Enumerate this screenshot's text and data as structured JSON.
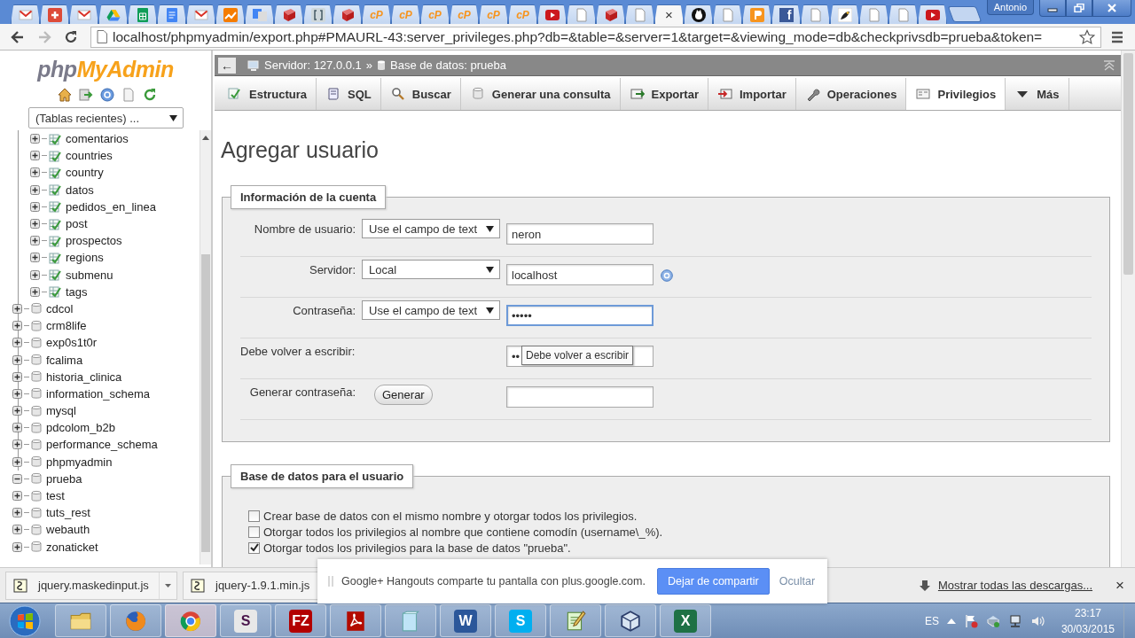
{
  "browser": {
    "tabs": [
      {
        "selected": false
      },
      {
        "selected": false
      },
      {
        "selected": false
      },
      {
        "selected": false
      },
      {
        "selected": false
      },
      {
        "selected": false
      },
      {
        "selected": false
      },
      {
        "selected": false
      },
      {
        "selected": false
      },
      {
        "selected": false
      },
      {
        "selected": false
      },
      {
        "selected": false
      },
      {
        "selected": false,
        "glyph": "cP"
      },
      {
        "selected": false,
        "glyph": "cP"
      },
      {
        "selected": false,
        "glyph": "cP"
      },
      {
        "selected": false,
        "glyph": "cP"
      },
      {
        "selected": false,
        "glyph": "cP"
      },
      {
        "selected": false,
        "glyph": "cP"
      },
      {
        "selected": false
      },
      {
        "selected": false
      },
      {
        "selected": false
      },
      {
        "selected": false
      },
      {
        "selected": true,
        "close": "×"
      },
      {
        "selected": false
      },
      {
        "selected": false
      },
      {
        "selected": false
      },
      {
        "selected": false,
        "glyph": "f"
      },
      {
        "selected": false
      },
      {
        "selected": false
      },
      {
        "selected": false
      },
      {
        "selected": false
      },
      {
        "selected": false
      }
    ],
    "profile": "Antonio",
    "url": "localhost/phpmyadmin/export.php#PMAURL-43:server_privileges.php?db=&table=&server=1&target=&viewing_mode=db&checkprivsdb=prueba&token="
  },
  "sidebar": {
    "logo": {
      "php": "php",
      "brand": "MyAdmin"
    },
    "recent_tables": "(Tablas recientes) ...",
    "tables": [
      {
        "name": "comentarios"
      },
      {
        "name": "countries"
      },
      {
        "name": "country"
      },
      {
        "name": "datos"
      },
      {
        "name": "pedidos_en_linea"
      },
      {
        "name": "post"
      },
      {
        "name": "prospectos"
      },
      {
        "name": "regions"
      },
      {
        "name": "submenu"
      },
      {
        "name": "tags"
      }
    ],
    "databases": [
      {
        "name": "cdcol",
        "expanded": false
      },
      {
        "name": "crm8life",
        "expanded": false
      },
      {
        "name": "exp0s1t0r",
        "expanded": false
      },
      {
        "name": "fcalima",
        "expanded": false
      },
      {
        "name": "historia_clinica",
        "expanded": false
      },
      {
        "name": "information_schema",
        "expanded": false
      },
      {
        "name": "mysql",
        "expanded": false
      },
      {
        "name": "pdcolom_b2b",
        "expanded": false
      },
      {
        "name": "performance_schema",
        "expanded": false
      },
      {
        "name": "phpmyadmin",
        "expanded": false
      },
      {
        "name": "prueba",
        "expanded": true
      },
      {
        "name": "test",
        "expanded": false
      },
      {
        "name": "tuts_rest",
        "expanded": false
      },
      {
        "name": "webauth",
        "expanded": false
      },
      {
        "name": "zonaticket",
        "expanded": false
      }
    ]
  },
  "breadcrumb": {
    "back": "←",
    "server": "Servidor: 127.0.0.1",
    "separator": "»",
    "database": "Base de datos: prueba"
  },
  "tabs": [
    {
      "label": "Estructura",
      "selected": false
    },
    {
      "label": "SQL",
      "selected": false
    },
    {
      "label": "Buscar",
      "selected": false
    },
    {
      "label": "Generar una consulta",
      "selected": false
    },
    {
      "label": "Exportar",
      "selected": false
    },
    {
      "label": "Importar",
      "selected": false
    },
    {
      "label": "Operaciones",
      "selected": false
    },
    {
      "label": "Privilegios",
      "selected": true
    },
    {
      "label": "Más",
      "selected": false
    }
  ],
  "heading": "Agregar usuario",
  "account": {
    "legend": "Información de la cuenta",
    "rows": [
      {
        "kind": "select",
        "label": "Nombre de usuario:",
        "option": "Use el campo de text",
        "value": "neron",
        "help": false,
        "focused": false
      },
      {
        "kind": "select",
        "label": "Servidor:",
        "option": "Local",
        "value": "localhost",
        "help": true,
        "focused": false
      },
      {
        "kind": "select",
        "label": "Contraseña:",
        "option": "Use el campo de text",
        "value": "•••••",
        "help": false,
        "focused": true
      },
      {
        "kind": "retype",
        "label": "Debe volver a escribir:",
        "value": "••",
        "tooltip": "Debe volver a escribir"
      },
      {
        "kind": "generate",
        "label": "Generar contraseña:",
        "button": "Generar"
      }
    ]
  },
  "database_options": {
    "legend": "Base de datos para el usuario",
    "options": [
      {
        "label": "Crear base de datos con el mismo nombre y otorgar todos los privilegios.",
        "checked": false
      },
      {
        "label": "Otorgar todos los privilegios al nombre que contiene comodín (username\\_%).",
        "checked": false
      },
      {
        "label": "Otorgar todos los privilegios para la base de datos \"prueba\".",
        "checked": true
      }
    ]
  },
  "downloads": {
    "items": [
      {
        "name": "jquery.maskedinput.js",
        "menu": true
      },
      {
        "name": "jquery-1.9.1.min.js"
      }
    ],
    "show_all": "Mostrar todas las descargas...",
    "close": "×"
  },
  "hangouts": {
    "message": "Google+ Hangouts comparte tu pantalla con plus.google.com.",
    "stop": "Dejar de compartir",
    "hide": "Ocultar"
  },
  "taskbar": {
    "apps": [
      {
        "selected": false
      },
      {
        "selected": false
      },
      {
        "selected": true
      },
      {
        "selected": false,
        "glyph": "S"
      },
      {
        "selected": false,
        "glyph": "FZ"
      },
      {
        "selected": false
      },
      {
        "selected": false
      },
      {
        "selected": false,
        "glyph": "W"
      },
      {
        "selected": false,
        "glyph": "S"
      },
      {
        "selected": false
      },
      {
        "selected": false
      },
      {
        "selected": false,
        "glyph": "X"
      }
    ],
    "language": "ES",
    "time": "23:17",
    "date": "30/03/2015"
  }
}
